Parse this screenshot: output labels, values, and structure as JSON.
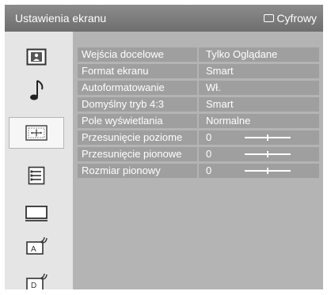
{
  "window": {
    "title": "Ustawienia ekranu",
    "source_label": "Cyfrowy",
    "source_icon": "tv-screen-icon"
  },
  "sidebar": {
    "items": [
      {
        "name": "picture-icon",
        "active": false
      },
      {
        "name": "music-note-icon",
        "active": false
      },
      {
        "name": "screen-settings-icon",
        "active": true
      },
      {
        "name": "features-list-icon",
        "active": false
      },
      {
        "name": "monitor-icon",
        "active": false
      },
      {
        "name": "analog-setup-icon",
        "active": false,
        "letter": "A"
      },
      {
        "name": "digital-setup-icon",
        "active": false,
        "letter": "D"
      }
    ]
  },
  "settings": {
    "rows": [
      {
        "label": "Wejścia docelowe",
        "value": "Tylko Oglądane"
      },
      {
        "label": "Format ekranu",
        "value": "Smart"
      },
      {
        "label": "Autoformatowanie",
        "value": "Wł."
      },
      {
        "label": "Domyślny tryb 4:3",
        "value": "Smart"
      },
      {
        "label": "Pole wyświetlania",
        "value": "Normalne"
      },
      {
        "label": "Przesunięcie poziome",
        "value": "0",
        "slider_position": 0.5
      },
      {
        "label": "Przesunięcie pionowe",
        "value": "0",
        "slider_position": 0.5
      },
      {
        "label": "Rozmiar pionowy",
        "value": "0",
        "slider_position": 0.5
      }
    ]
  },
  "colors": {
    "title_bar": "#7d7d7d",
    "content_bg": "#b4b4b4",
    "row_bg": "#9f9f9f",
    "sidebar_bg": "#e5e5e5"
  }
}
